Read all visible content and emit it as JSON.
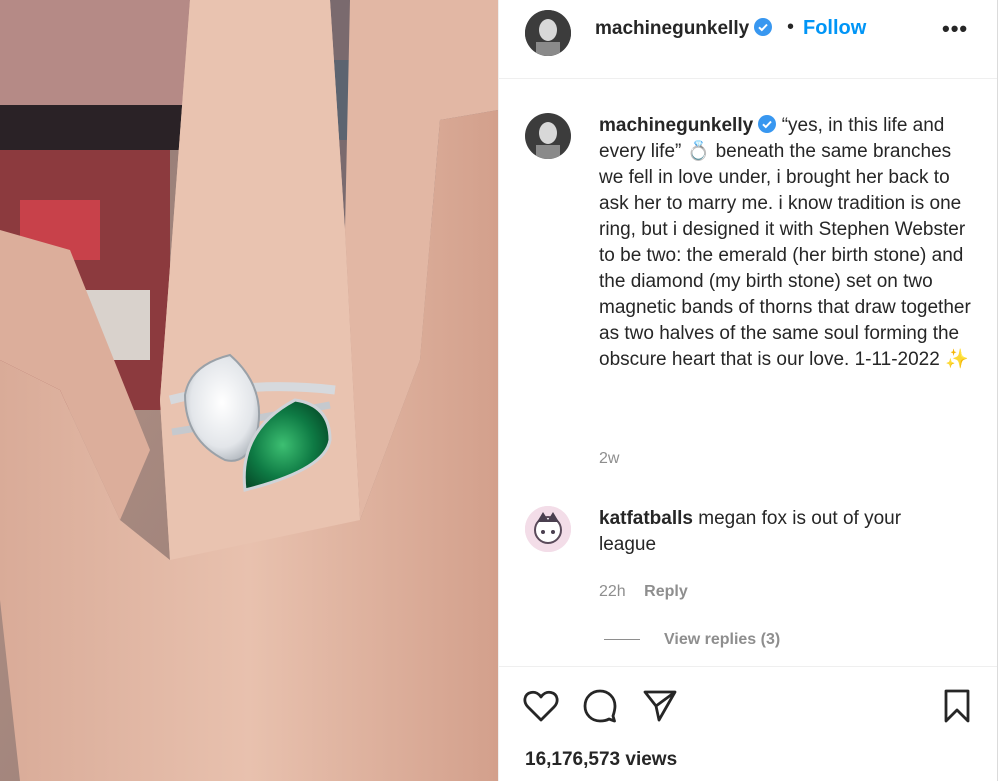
{
  "post": {
    "username": "machinegunkelly",
    "follow_label": "Follow",
    "dot": "•",
    "more": "•••",
    "image_alt": "Ring with diamond and emerald on a hand"
  },
  "caption": {
    "username": "machinegunkelly",
    "text_part1": "“yes, in this life and every life”",
    "ring_emoji": "💍",
    "text_part2": " beneath the same branches we fell in love under, i brought her back to ask her to marry me. i know tradition is one ring, but i designed it with Stephen Webster to be two: the emerald (her birth stone) and the diamond (my birth stone) set on two magnetic bands of thorns that draw together as two halves of the same soul forming the obscure heart that is our love. 1-11-2022 ",
    "sparkle_emoji": "✨",
    "time": "2w"
  },
  "comment": {
    "username": "katfatballs",
    "text": " megan fox is out of your league",
    "time": "22h",
    "reply_label": "Reply",
    "view_replies": "View replies (3)"
  },
  "actions": {
    "views": "16,176,573 views"
  },
  "colors": {
    "accent": "#0095f6",
    "verified": "#3897f0",
    "muted": "#8e8e8e",
    "emerald": "#0e7a44"
  }
}
